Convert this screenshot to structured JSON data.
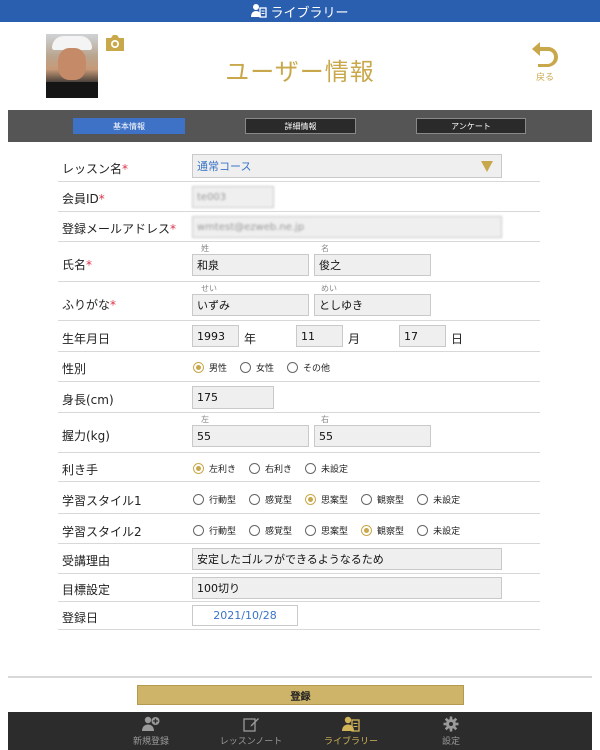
{
  "topbar": {
    "title": "ライブラリー",
    "icon": "library-icon"
  },
  "header": {
    "title": "ユーザー情報",
    "back_label": "戻る"
  },
  "tabs": [
    {
      "label": "基本情報",
      "active": true
    },
    {
      "label": "詳細情報",
      "active": false
    },
    {
      "label": "アンケート",
      "active": false
    }
  ],
  "form": {
    "lesson": {
      "label": "レッスン名",
      "value": "通常コース"
    },
    "member_id": {
      "label": "会員ID",
      "value": "te003"
    },
    "email": {
      "label": "登録メールアドレス",
      "value": "wmtest@ezweb.ne.jp"
    },
    "name": {
      "label": "氏名",
      "sub_last": "姓",
      "sub_first": "名",
      "last": "和泉",
      "first": "俊之"
    },
    "kana": {
      "label": "ふりがな",
      "sub_last": "せい",
      "sub_first": "めい",
      "last": "いずみ",
      "first": "としゆき"
    },
    "birthday": {
      "label": "生年月日",
      "year": "1993",
      "year_unit": "年",
      "month": "11",
      "month_unit": "月",
      "day": "17",
      "day_unit": "日"
    },
    "gender": {
      "label": "性別",
      "options": [
        "男性",
        "女性",
        "その他"
      ],
      "selected": 0
    },
    "height": {
      "label": "身長(cm)",
      "value": "175"
    },
    "grip": {
      "label": "握力(kg)",
      "sub_left": "左",
      "sub_right": "右",
      "left": "55",
      "right": "55"
    },
    "hand": {
      "label": "利き手",
      "options": [
        "左利き",
        "右利き",
        "未設定"
      ],
      "selected": 0
    },
    "style1": {
      "label": "学習スタイル1",
      "options": [
        "行動型",
        "感覚型",
        "思案型",
        "観察型",
        "未設定"
      ],
      "selected": 2
    },
    "style2": {
      "label": "学習スタイル2",
      "options": [
        "行動型",
        "感覚型",
        "思案型",
        "観察型",
        "未設定"
      ],
      "selected": 3
    },
    "reason": {
      "label": "受講理由",
      "value": "安定したゴルフができるようなるため"
    },
    "goal": {
      "label": "目標設定",
      "value": "100切り"
    },
    "regdate": {
      "label": "登録日",
      "value": "2021/10/28"
    }
  },
  "submit_label": "登録",
  "bottom_nav": [
    {
      "label": "新規登録",
      "icon": "add-user-icon",
      "active": false
    },
    {
      "label": "レッスンノート",
      "icon": "note-edit-icon",
      "active": false
    },
    {
      "label": "ライブラリー",
      "icon": "library-icon",
      "active": true
    },
    {
      "label": "設定",
      "icon": "gear-icon",
      "active": false
    }
  ],
  "colors": {
    "accent": "#c9a84c",
    "topbar": "#2a5fb0",
    "tab_active": "#3e72c6",
    "required": "#e0334a"
  }
}
